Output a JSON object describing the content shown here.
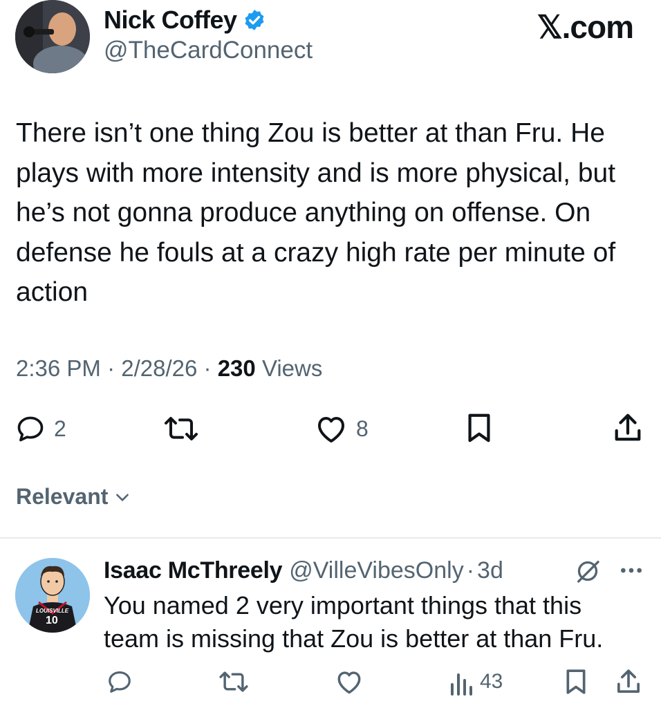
{
  "brand": {
    "logo_text": "𝕏.com"
  },
  "tweet": {
    "author_name": "Nick Coffey",
    "author_handle": "@TheCardConnect",
    "text": "There isn’t one thing Zou is better at than Fru. He plays with more intensity and is more physical, but he’s not gonna produce anything on offense. On defense he fouls at a crazy high rate per minute of action",
    "time": "2:36 PM",
    "date": "2/28/26",
    "views_count": "230",
    "views_label": "Views",
    "separator": "·",
    "reply_count": "2",
    "like_count": "8"
  },
  "sort": {
    "label": "Relevant"
  },
  "reply": {
    "author_name": "Isaac McThreely",
    "author_handle": "@VilleVibesOnly",
    "age": "3d",
    "separator": "·",
    "text": "You named 2 very important things that this team is missing that Zou is better at than Fru.",
    "views_count": "43",
    "jersey_text": "LOUISVILLE",
    "jersey_number": "10"
  },
  "colors": {
    "accent": "#1d9bf0",
    "secondary_text": "#536471",
    "primary_text": "#0f1419",
    "divider": "#e7e9ea"
  },
  "icons": [
    "verified-badge-icon",
    "reply-icon",
    "retweet-icon",
    "like-icon",
    "bookmark-icon",
    "share-icon",
    "views-icon",
    "grok-icon",
    "more-icon",
    "chevron-down-icon"
  ]
}
